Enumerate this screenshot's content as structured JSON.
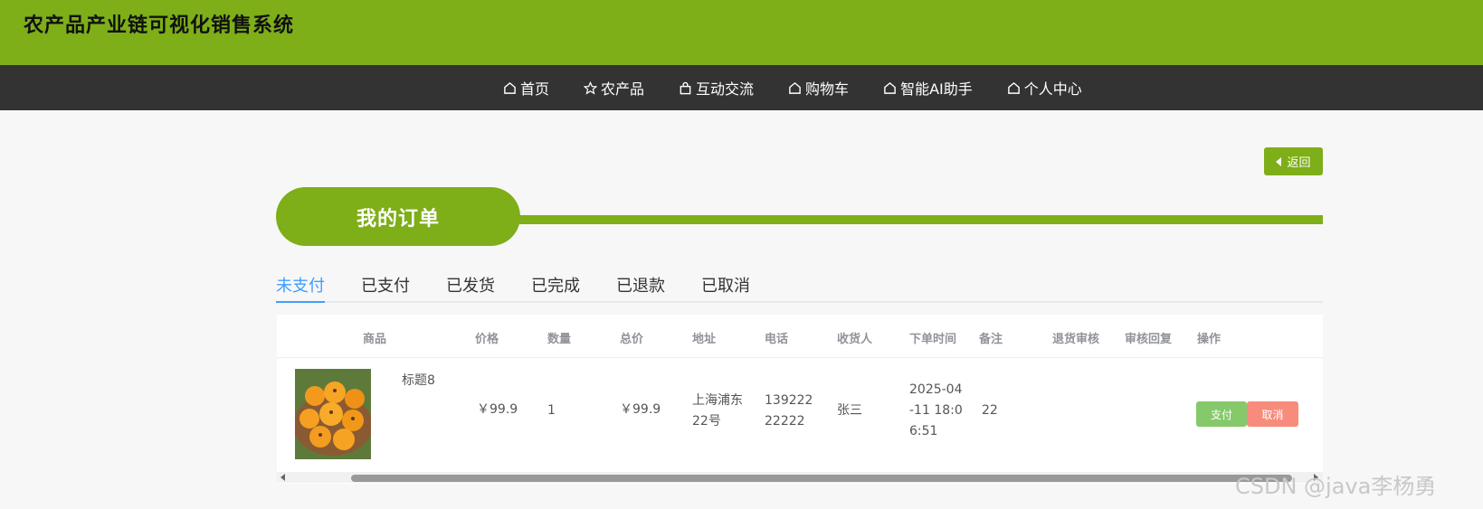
{
  "header": {
    "title": "农产品产业链可视化销售系统",
    "accent": "#7eae18"
  },
  "nav": {
    "items": [
      {
        "label": "首页",
        "icon": "home-icon"
      },
      {
        "label": "农产品",
        "icon": "star-icon"
      },
      {
        "label": "互动交流",
        "icon": "bag-icon"
      },
      {
        "label": "购物车",
        "icon": "home-icon"
      },
      {
        "label": "智能AI助手",
        "icon": "home-icon"
      },
      {
        "label": "个人中心",
        "icon": "home-icon"
      }
    ]
  },
  "back_label": "返回",
  "page_title": "我的订单",
  "tabs": [
    "未支付",
    "已支付",
    "已发货",
    "已完成",
    "已退款",
    "已取消"
  ],
  "table": {
    "columns": [
      "商品",
      "价格",
      "数量",
      "总价",
      "地址",
      "电话",
      "收货人",
      "下单时间",
      "备注",
      "退货审核",
      "审核回复",
      "操作"
    ],
    "rows": [
      {
        "product_name": "标题8",
        "price": "￥99.9",
        "quantity": "1",
        "total": "￥99.9",
        "address": "上海浦东22号",
        "phone": "13922222222",
        "receiver": "张三",
        "order_time": "2025-04-11 18:06:51",
        "note": "22",
        "return_review": "",
        "review_reply": "",
        "actions": {
          "pay": "支付",
          "cancel": "取消"
        }
      }
    ]
  },
  "watermark": "CSDN @java李杨勇"
}
